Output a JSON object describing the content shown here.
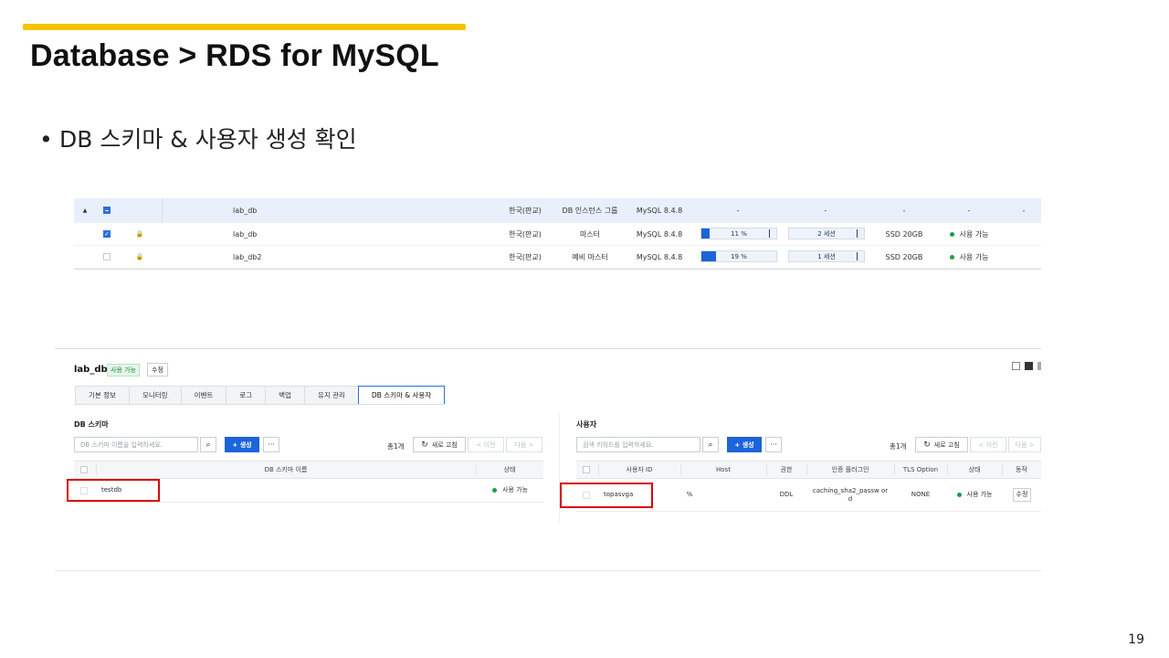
{
  "slide": {
    "title": "Database > RDS for MySQL",
    "bullet": "DB 스키마 & 사용자 생성 확인",
    "page_number": "19",
    "accent_color": "#f5c400"
  },
  "instances": {
    "rows": [
      {
        "name": "lab_db",
        "region": "한국(판교)",
        "role": "DB 인스턴스 그룹",
        "version": "MySQL 8.4.8",
        "cpu": "-",
        "sessions": "-",
        "storage": "-",
        "status": "-",
        "extra": "-"
      },
      {
        "name": "lab_db",
        "region": "한국(판교)",
        "role": "마스터",
        "version": "MySQL 8.4.8",
        "cpu": "11 %",
        "cpu_fraction": 0.11,
        "sessions": "2 세션",
        "storage": "SSD 20GB",
        "status": "사용 가능"
      },
      {
        "name": "lab_db2",
        "region": "한국(판교)",
        "role": "예비 마스터",
        "version": "MySQL 8.4.8",
        "cpu": "19 %",
        "cpu_fraction": 0.19,
        "sessions": "1 세션",
        "storage": "SSD 20GB",
        "status": "사용 가능"
      }
    ]
  },
  "detail": {
    "name": "lab_db",
    "status_badge": "사용 가능",
    "edit_label": "수정",
    "tabs": [
      "기본 정보",
      "모니터링",
      "이벤트",
      "로그",
      "백업",
      "유지 관리",
      "DB 스키마 & 사용자"
    ],
    "active_tab": "DB 스키마 & 사용자"
  },
  "schema": {
    "title": "DB 스키마",
    "search_placeholder": "DB 스키마 이름을 입력하세요.",
    "create_label": "+ 생성",
    "more_label": "···",
    "count": "총1개",
    "refresh_label": "새로 고침",
    "prev_label": "< 이전",
    "next_label": "다음 >",
    "columns": [
      "DB 스키마 이름",
      "상태"
    ],
    "rows": [
      {
        "name": "testdb",
        "status": "사용 가능"
      }
    ]
  },
  "users": {
    "title": "사용자",
    "search_placeholder": "검색 키워드를 입력하세요.",
    "create_label": "+ 생성",
    "more_label": "···",
    "count": "총1개",
    "refresh_label": "새로 고침",
    "prev_label": "< 이전",
    "next_label": "다음 >",
    "columns": [
      "사용자 ID",
      "Host",
      "권한",
      "인증 플러그인",
      "TLS Option",
      "상태",
      "동작"
    ],
    "rows": [
      {
        "id": "topasvga",
        "host": "%",
        "privilege": "DDL",
        "plugin": "caching_sha2_passw ord",
        "tls": "NONE",
        "status": "사용 가능",
        "action": "수정"
      }
    ]
  },
  "colors": {
    "primary": "#1b64da",
    "status_green": "#1e9e4a",
    "highlight": "#d90000"
  }
}
